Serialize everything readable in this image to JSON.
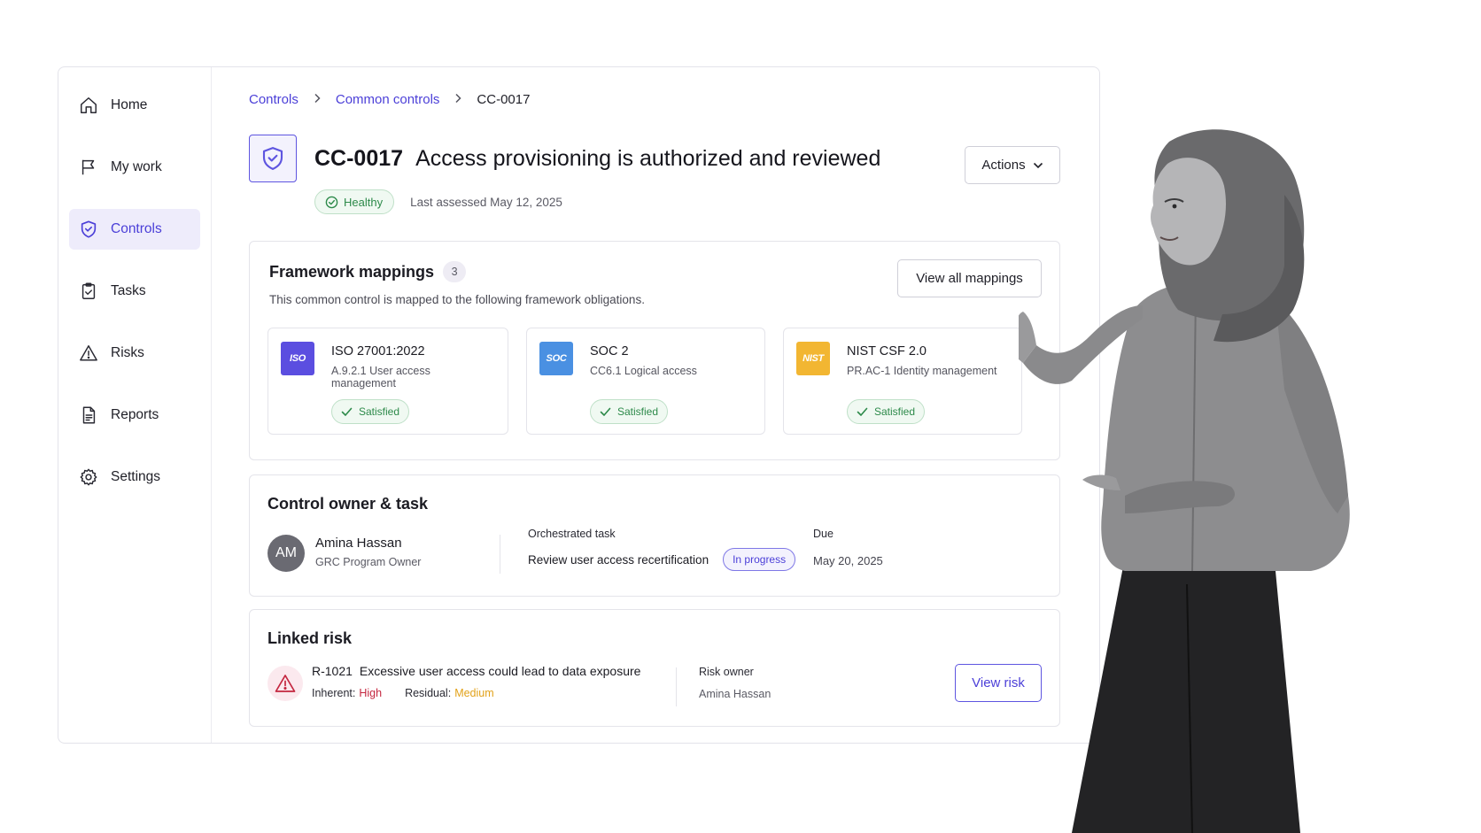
{
  "sidebar": {
    "items": [
      {
        "label": "Home",
        "icon": "home-icon"
      },
      {
        "label": "My work",
        "icon": "flag-icon"
      },
      {
        "label": "Controls",
        "icon": "shield-check-icon",
        "active": true
      },
      {
        "label": "Tasks",
        "icon": "clipboard-check-icon"
      },
      {
        "label": "Risks",
        "icon": "warning-triangle-icon"
      },
      {
        "label": "Reports",
        "icon": "document-icon"
      },
      {
        "label": "Settings",
        "icon": "gear-icon"
      }
    ]
  },
  "breadcrumb": {
    "items": [
      "Controls",
      "Common controls"
    ],
    "current": "CC-0017"
  },
  "control": {
    "id": "CC-0017",
    "title": "Access provisioning is authorized and reviewed",
    "status": "Healthy",
    "last_assessed": "Last assessed May 12, 2025",
    "actions_label": "Actions"
  },
  "framework_mappings": {
    "title": "Framework mappings",
    "count": "3",
    "view_all_label": "View all mappings",
    "description": "This common control is mapped to the following framework obligations.",
    "items": [
      {
        "logo": "ISO",
        "logo_color": "#5b4ee0",
        "name": "ISO 27001:2022",
        "requirement": "A.9.2.1 User access management",
        "status": "Satisfied"
      },
      {
        "logo": "SOC",
        "logo_color": "#4a90e2",
        "name": "SOC 2",
        "requirement": "CC6.1 Logical access",
        "status": "Satisfied"
      },
      {
        "logo": "NIST",
        "logo_color": "#f2b632",
        "name": "NIST CSF 2.0",
        "requirement": "PR.AC-1 Identity management",
        "status": "Satisfied"
      }
    ]
  },
  "owner_task": {
    "title": "Control owner & task",
    "owner_initials": "AM",
    "owner_name": "Amina Hassan",
    "owner_role": "GRC Program Owner",
    "task_label": "Orchestrated task",
    "task_name": "Review user access recertification",
    "task_status": "In progress",
    "due_label": "Due",
    "due_date": "May 20, 2025"
  },
  "linked_risk": {
    "title": "Linked risk",
    "risk_id": "R-1021",
    "risk_title": "Excessive user access could lead to data exposure",
    "inherent_label": "Inherent:",
    "inherent_value": "High",
    "residual_label": "Residual:",
    "residual_value": "Medium",
    "owner_label": "Risk owner",
    "owner_name": "Amina Hassan",
    "view_label": "View risk"
  },
  "colors": {
    "accent": "#4b3fd8",
    "success": "#2d8a4a",
    "danger": "#c4263f",
    "warning": "#e2a21a"
  }
}
